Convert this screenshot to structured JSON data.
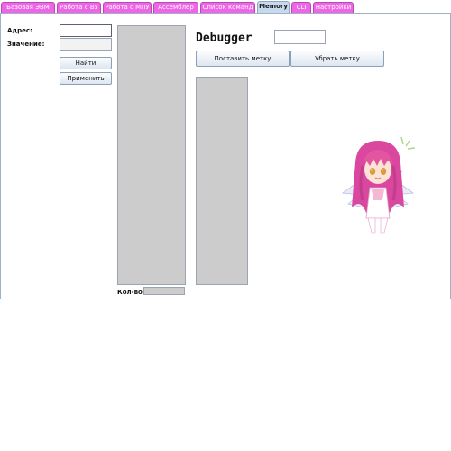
{
  "tabs": [
    {
      "label": "Базовая ЭВМ",
      "active": false
    },
    {
      "label": "Работа с ВУ",
      "active": false
    },
    {
      "label": "Работа с МПУ",
      "active": false
    },
    {
      "label": "Ассемблер",
      "active": false
    },
    {
      "label": "Список команд",
      "active": false
    },
    {
      "label": "Memory",
      "active": true
    },
    {
      "label": "CLI",
      "active": false
    },
    {
      "label": "Настройки",
      "active": false
    }
  ],
  "memory": {
    "address_label": "Адрес:",
    "address_value": "",
    "value_label": "Значение:",
    "value_value": "",
    "find_button": "Найти",
    "apply_button": "Применить",
    "count_label": "Кол-во:",
    "count_value": ""
  },
  "debugger": {
    "title": "Debugger",
    "input_value": "",
    "set_breakpoint_button": "Поставить метку",
    "remove_breakpoint_button": "Убрать метку"
  },
  "colors": {
    "tab_inactive": "#ee66e6",
    "tab_active": "#c7d9ec",
    "list_bg": "#cccccc"
  },
  "icons": {
    "mascot": "anime-girl-mascot-image"
  }
}
